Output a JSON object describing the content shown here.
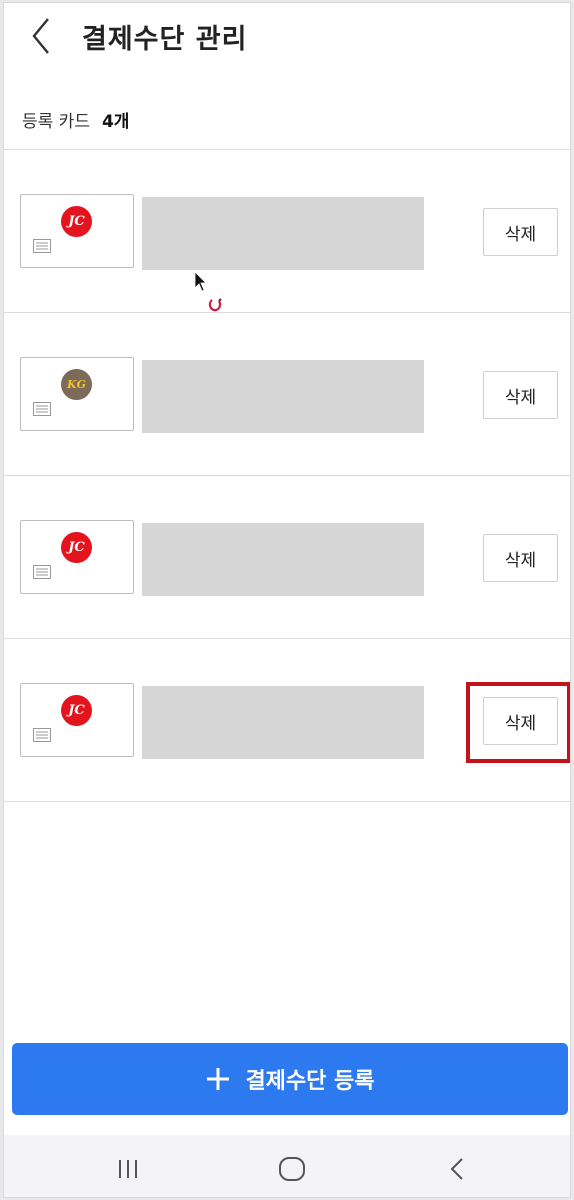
{
  "header": {
    "title": "결제수단 관리"
  },
  "summary": {
    "label": "등록 카드",
    "count": "4개"
  },
  "cards": [
    {
      "logo_text": "JC",
      "logo_color": "#e4141f",
      "delete_label": "삭제"
    },
    {
      "logo_text": "KG",
      "logo_color": "#7b6b58",
      "delete_label": "삭제"
    },
    {
      "logo_text": "JC",
      "logo_color": "#e4141f",
      "delete_label": "삭제"
    },
    {
      "logo_text": "JC",
      "logo_color": "#e4141f",
      "delete_label": "삭제",
      "highlighted": true
    }
  ],
  "register_button": {
    "label": "결제수단 등록"
  },
  "icons": {
    "back": "chevron-left-icon",
    "plus": "plus-icon",
    "nav_recent": "recent-apps-icon",
    "nav_home": "home-icon",
    "nav_back": "back-icon"
  },
  "colors": {
    "accent": "#2d7af0",
    "highlight": "#c3141c"
  }
}
